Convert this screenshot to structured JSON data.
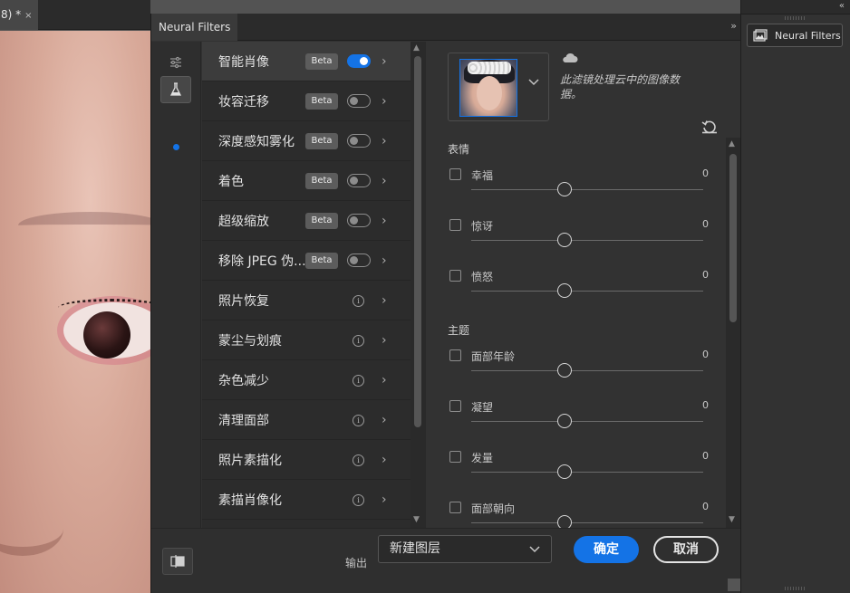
{
  "document": {
    "tab_label": "8) *",
    "close_glyph": "×"
  },
  "dialog": {
    "title": "Neural Filters",
    "collapse_glyph": "»",
    "rail": {
      "icons": [
        "sliders-icon",
        "flask-icon"
      ]
    },
    "filters": [
      {
        "name": "智能肖像",
        "badge": "Beta",
        "control": "toggle",
        "on": true,
        "selected": true
      },
      {
        "name": "妆容迁移",
        "badge": "Beta",
        "control": "toggle",
        "on": false,
        "selected": false
      },
      {
        "name": "深度感知雾化",
        "badge": "Beta",
        "control": "toggle",
        "on": false,
        "selected": false
      },
      {
        "name": "着色",
        "badge": "Beta",
        "control": "toggle",
        "on": false,
        "selected": false
      },
      {
        "name": "超级缩放",
        "badge": "Beta",
        "control": "toggle",
        "on": false,
        "selected": false
      },
      {
        "name": "移除 JPEG 伪...",
        "badge": "Beta",
        "control": "toggle",
        "on": false,
        "selected": false
      },
      {
        "name": "照片恢复",
        "badge": "",
        "control": "info",
        "on": false,
        "selected": false
      },
      {
        "name": "蒙尘与划痕",
        "badge": "",
        "control": "info",
        "on": false,
        "selected": false
      },
      {
        "name": "杂色减少",
        "badge": "",
        "control": "info",
        "on": false,
        "selected": false
      },
      {
        "name": "清理面部",
        "badge": "",
        "control": "info",
        "on": false,
        "selected": false
      },
      {
        "name": "照片素描化",
        "badge": "",
        "control": "info",
        "on": false,
        "selected": false
      },
      {
        "name": "素描肖像化",
        "badge": "",
        "control": "info",
        "on": false,
        "selected": false
      }
    ],
    "settings": {
      "cloud_text": "此滤镜处理云中的图像数据。",
      "sections": [
        {
          "title": "表情",
          "params": [
            {
              "label": "幸福",
              "value": "0",
              "slider": 0
            },
            {
              "label": "惊讶",
              "value": "0",
              "slider": 0
            },
            {
              "label": "愤怒",
              "value": "0",
              "slider": 0
            }
          ]
        },
        {
          "title": "主题",
          "params": [
            {
              "label": "面部年龄",
              "value": "0",
              "slider": 0
            },
            {
              "label": "凝望",
              "value": "0",
              "slider": 0
            },
            {
              "label": "发量",
              "value": "0",
              "slider": 0
            },
            {
              "label": "面部朝向",
              "value": "0",
              "slider": 0
            }
          ]
        }
      ]
    },
    "footer": {
      "output_label": "输出",
      "output_value": "新建图层",
      "ok_label": "确定",
      "cancel_label": "取消"
    }
  },
  "right_panel": {
    "collapse_glyph": "«",
    "button_label": "Neural Filters"
  },
  "colors": {
    "accent": "#1473e6",
    "panel": "#323232",
    "list": "#2c2c2c"
  }
}
